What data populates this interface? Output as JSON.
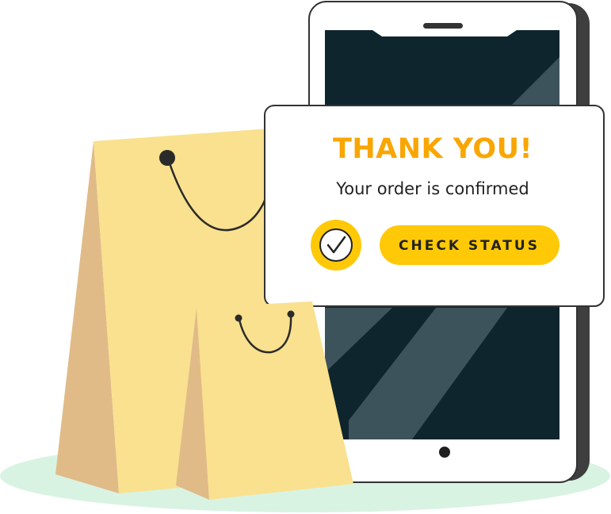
{
  "card": {
    "title": "THANK YOU!",
    "message": "Your order is confirmed",
    "button_label": "CHECK STATUS"
  },
  "icons": {
    "confirmation": "check-circle-icon",
    "phone_button": "home-button-icon"
  },
  "colors": {
    "accent": "#F9A602",
    "button": "#FFC907",
    "screen": "#0F252E",
    "bag": "#F9E18F",
    "bag_shadow": "#E0BB88",
    "ground": "#D9F3E3"
  }
}
